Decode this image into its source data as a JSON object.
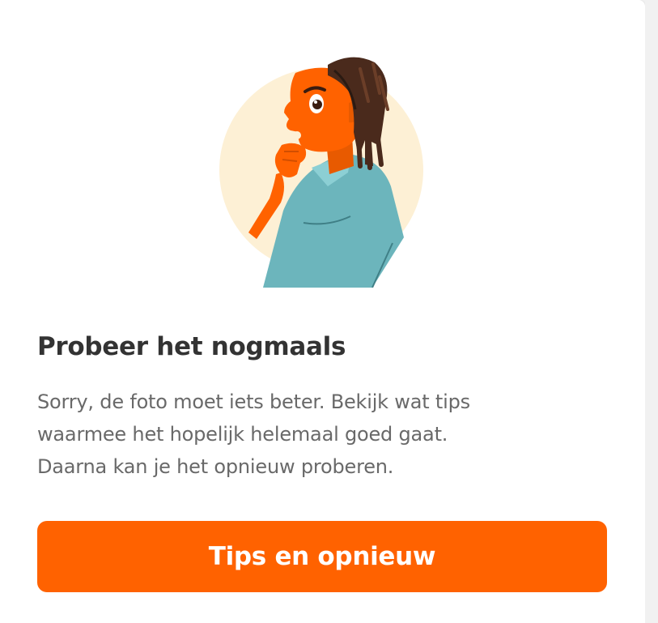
{
  "card": {
    "illustration_icon": "thinking-person-illustration",
    "title": "Probeer het nogmaals",
    "message_lines": [
      "Sorry, de foto moet iets beter. Bekijk wat tips",
      "waarmee het hopelijk helemaal goed gaat.",
      "Daarna kan je het opnieuw proberen."
    ],
    "button_label": "Tips en opnieuw"
  },
  "colors": {
    "accent": "#ff6200",
    "skin": "#ff6200",
    "shirt": "#6cb5bc",
    "hair": "#4a2a1c",
    "circle": "#fdf0d5",
    "title_text": "#333333",
    "body_text": "#696969"
  }
}
